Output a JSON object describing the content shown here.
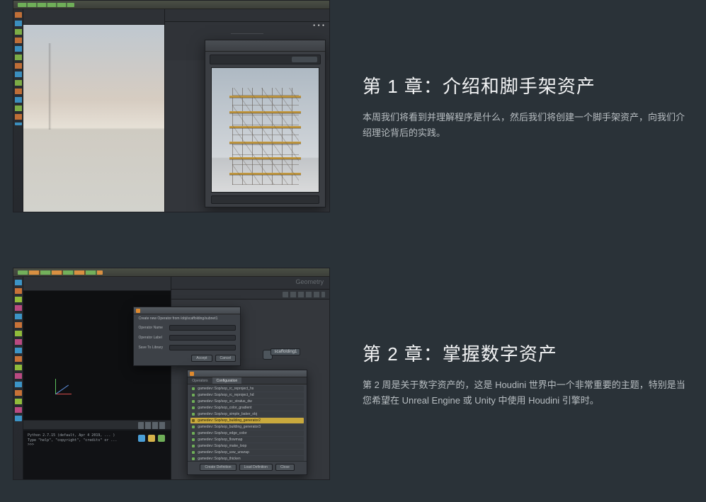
{
  "chapters": [
    {
      "title": "第 1 章：介绍和脚手架资产",
      "desc": "本周我们将看到并理解程序是什么，然后我们将创建一个脚手架资产，向我们介绍理论背后的实践。"
    },
    {
      "title": "第 2 章：掌握数字资产",
      "desc": "第 2 周是关于数字资产的，这是 Houdini 世界中一个非常重要的主题，特别是当您希望在 Unreal Engine 或 Unity 中使用 Houdini 引擎时。"
    }
  ],
  "thumb2": {
    "geometry_label": "Geometry",
    "console_lines": [
      "Python 2.7.15 (default, Apr 4 2019, ... )",
      "Type \"help\", \"copyright\", \"credits\" or ...",
      ">>>"
    ],
    "dlg1_rows": [
      "Operator Name",
      "Operator Label",
      "Save To Library"
    ],
    "dlg1_buttons": [
      "Accept",
      "Cancel"
    ],
    "dlg2_tabs": [
      "Operators",
      "Configuration"
    ],
    "dlg2_items": [
      "gamedev::Sop/sop_rc_reproject_hs",
      "gamedev::Sop/sop_rc_reproject_hd",
      "gamedev::Sop/sop_sc_stratus_dw",
      "gamedev::Sop/sop_color_gradient",
      "gamedev::Sop/sop_simple_baker_obj",
      "gamedev::Sop/sop_building_generator2",
      "gamedev::Sop/sop_building_generator3",
      "gamedev::Sop/sop_edge_color",
      "gamedev::Sop/sop_flowmap",
      "gamedev::Sop/sop_make_loop",
      "gamedev::Sop/sop_uvw_unwrap",
      "gamedev::Sop/sop_thicken"
    ],
    "dlg2_selected_index": 5,
    "dlg2_buttons": [
      "Create Definition",
      "Load Definition",
      "Close"
    ],
    "tooltip": "scaffolding1"
  }
}
